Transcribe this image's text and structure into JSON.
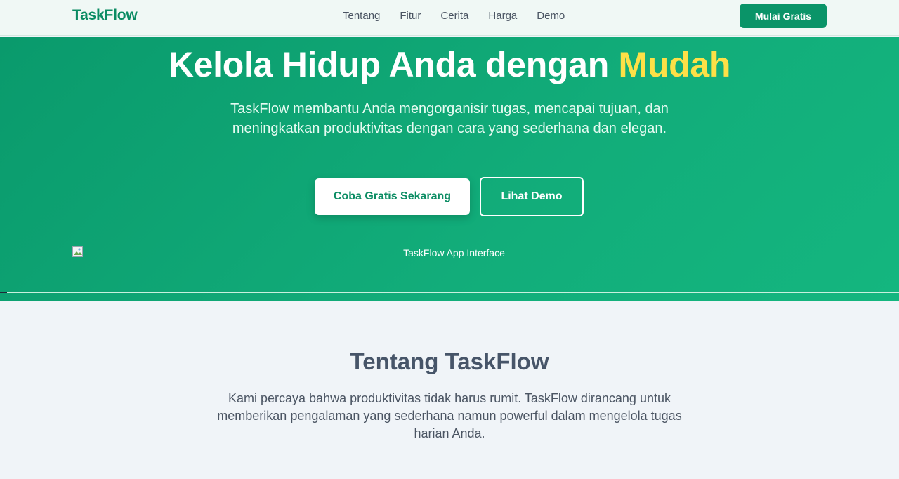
{
  "brand": {
    "name": "TaskFlow",
    "primary_color": "#0a9468",
    "accent_color": "#fde047"
  },
  "nav": {
    "links": [
      "Tentang",
      "Fitur",
      "Cerita",
      "Harga",
      "Demo"
    ],
    "cta_label": "Mulai Gratis"
  },
  "hero": {
    "title_main": "Kelola Hidup Anda dengan ",
    "title_accent": "Mudah",
    "subtitle": "TaskFlow membantu Anda mengorganisir tugas, mencapai tujuan, dan meningkatkan produktivitas dengan cara yang sederhana dan elegan.",
    "primary_button": "Coba Gratis Sekarang",
    "secondary_button": "Lihat Demo",
    "image_alt": "TaskFlow App Interface",
    "image_icon": "broken-image-icon"
  },
  "about": {
    "title": "Tentang TaskFlow",
    "text": "Kami percaya bahwa produktivitas tidak harus rumit. TaskFlow dirancang untuk memberikan pengalaman yang sederhana namun powerful dalam mengelola tugas harian Anda."
  }
}
